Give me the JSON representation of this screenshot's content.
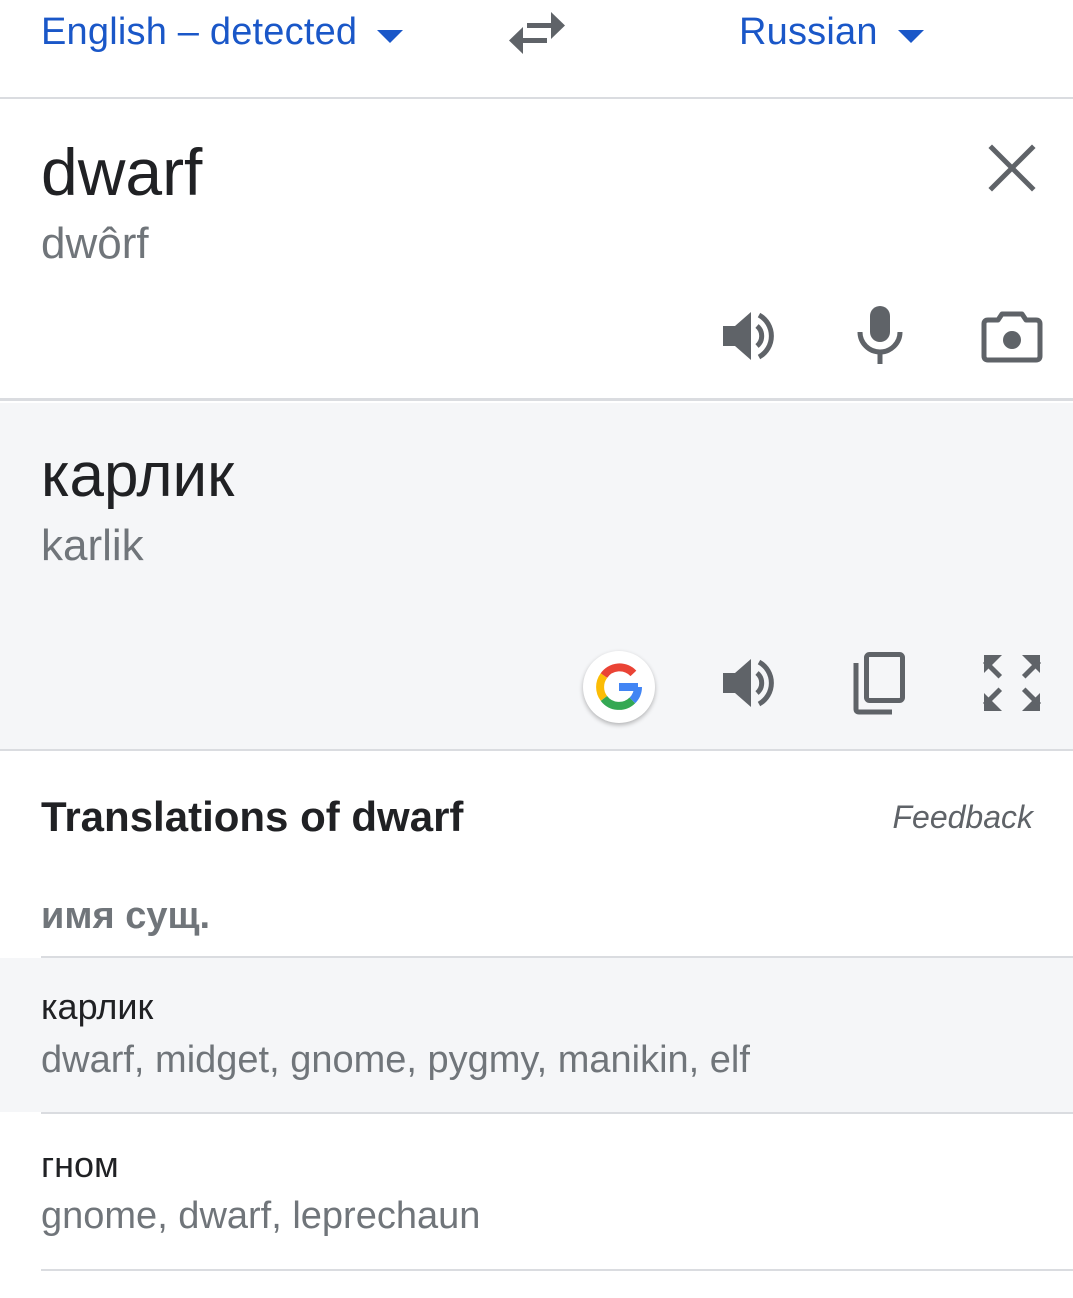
{
  "lang_bar": {
    "source_lang": "English – detected",
    "target_lang": "Russian"
  },
  "source": {
    "text": "dwarf",
    "transliteration": "dwôrf"
  },
  "result": {
    "text": "карлик",
    "transliteration": "karlik"
  },
  "translations": {
    "heading": "Translations of dwarf",
    "feedback": "Feedback",
    "part_of_speech": "имя сущ.",
    "rows": [
      {
        "word": "карлик",
        "synonyms": "dwarf, midget, gnome, pygmy, manikin, elf"
      },
      {
        "word": "гном",
        "synonyms": "gnome, dwarf, leprechaun"
      }
    ]
  },
  "icons": {
    "swap": "swap-arrows-icon",
    "close": "close-icon",
    "speaker": "speaker-icon",
    "mic": "microphone-icon",
    "camera": "camera-icon",
    "google": "google-g-icon",
    "copy": "copy-icon",
    "fullscreen": "fullscreen-icon"
  },
  "colors": {
    "accent": "#1a57c8",
    "result_bg": "#f5f6f8",
    "secondary_text": "#70757a",
    "divider": "#dadce0"
  }
}
